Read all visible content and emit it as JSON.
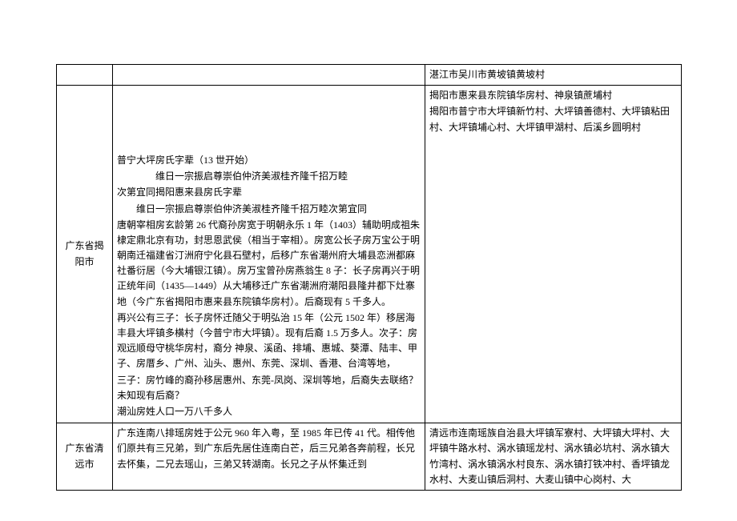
{
  "rows": [
    {
      "col1": "",
      "col2": "",
      "col3": "湛江市吴川市黄坡镇黄坡村"
    },
    {
      "col1": "广东省揭阳市",
      "col2_lines": [
        {
          "cls": "para",
          "text": ""
        },
        {
          "cls": "para",
          "text": ""
        },
        {
          "cls": "para",
          "text": ""
        },
        {
          "cls": "para",
          "text": ""
        },
        {
          "cls": "para",
          "text": "普宁大坪房氏字辈（13 世开始）"
        },
        {
          "cls": "para indent2",
          "text": "维日一宗振启尊崇伯仲济美淑桂齐隆千招万睦"
        },
        {
          "cls": "para",
          "text": "次第宜同揭阳惠来县房氏字辈"
        },
        {
          "cls": "para indent3",
          "text": "维日一宗振启尊崇伯仲济美淑桂齐隆千招万睦次第宜同"
        },
        {
          "cls": "para",
          "text": "唐朝宰相房玄龄第 26 代裔孙房宽于明朝永乐 1 年（1403）辅助明成祖朱棣定鼎北京有功，封思恩武侯（相当于宰相）。房宽公长子房万宝公于明朝南迁福建省汀洲府宁化县石壁村，后移广东省潮州府大埔县恋洲都麻社番衍居（今大埔银江镇）。房万宝曾孙房燕翁生 8 子：长子房再兴于明正统年间（1435—1449）从大埔移迁广东省潮洲府潮阳县隆井都下灶寨地（今广东省揭阳市惠来县东院镇华房村）。后裔现有 5 千多人。"
        },
        {
          "cls": "para",
          "text": "再兴公有三子：长子房怀迁随父于明弘治 15 年（公元 1502 年）移居海丰县大坪镇多横村（今普宁市大坪镇）。现有后裔 1.5 万多人。次子：房观远顺母守桃华房村，裔分 神泉、溪函、排埔、惠城、葵潭、陆丰、甲子、房厝乡、广州、汕头、惠州、东莞、深圳、香港、台湾等地，"
        },
        {
          "cls": "para",
          "text": "三子：房竹峰的裔孙移居惠州、东莞-凤岗、深圳等地，后裔失去联络？未知现有后裔？"
        },
        {
          "cls": "para",
          "text": "潮汕房姓人口一万八千多人"
        }
      ],
      "col3_lines": [
        {
          "cls": "para",
          "text": "揭阳市惠来县东院镇华房村、神泉镇蔗埔村"
        },
        {
          "cls": "para",
          "text": "揭阳市普宁市大坪镇新竹村、大坪镇善德村、大坪镇粘田村、大坪镇埔心村、大坪镇甲湖村、后溪乡圆明村"
        }
      ]
    },
    {
      "col1": "广东省清远市",
      "col2": "广东连南八排瑶房姓于公元 960 年入粤，至 1985 年已传 41 代。相传他们原共有三兄弟，到广东后先居住连南白芒，后三兄弟各奔前程，长兄去怀集，二兄去瑶山，三弟又转湖南。长兄之子从怀集迁到",
      "col3": "清远市连南瑶族自治县大坪镇军寮村、大坪镇大坪村、大坪镇牛路水村、涡水镇瑶龙村、涡水镇必坑村、涡水镇大竹湾村、涡水镇涡水村良东、涡水镇打铁冲村、香坪镇龙水村、大麦山镇后洞村、大麦山镇中心岗村、大"
    }
  ]
}
